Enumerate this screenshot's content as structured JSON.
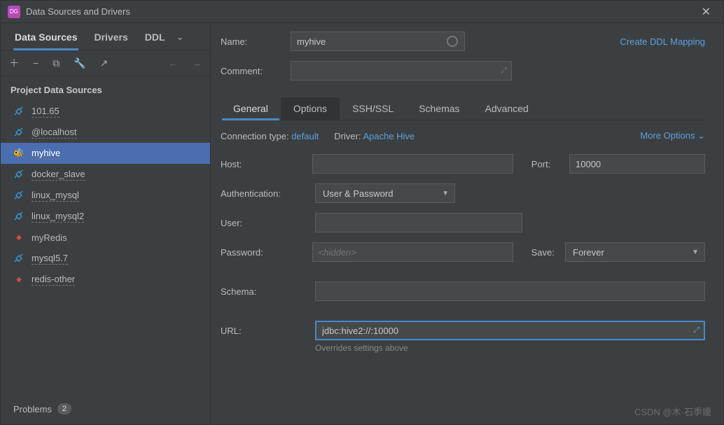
{
  "window": {
    "title": "Data Sources and Drivers"
  },
  "sidebar": {
    "tabs": [
      {
        "label": "Data Sources",
        "active": true
      },
      {
        "label": "Drivers",
        "active": false
      },
      {
        "label": "DDL",
        "active": false
      }
    ],
    "section_header": "Project Data Sources",
    "items": [
      {
        "label": "101.65",
        "icon": "plug",
        "dotted": true,
        "selected": false
      },
      {
        "label": "@localhost",
        "icon": "plug",
        "dotted": true,
        "selected": false
      },
      {
        "label": "myhive",
        "icon": "hive",
        "dotted": true,
        "selected": true
      },
      {
        "label": "docker_slave",
        "icon": "plug",
        "dotted": true,
        "selected": false
      },
      {
        "label": "linux_mysql",
        "icon": "plug",
        "dotted": true,
        "selected": false
      },
      {
        "label": "linux_mysql2",
        "icon": "plug",
        "dotted": true,
        "selected": false
      },
      {
        "label": "myRedis",
        "icon": "redis",
        "dotted": false,
        "selected": false
      },
      {
        "label": "mysql5.7",
        "icon": "plug",
        "dotted": true,
        "selected": false
      },
      {
        "label": "redis-other",
        "icon": "redis",
        "dotted": true,
        "selected": false
      }
    ],
    "problems_label": "Problems",
    "problems_count": "2"
  },
  "form": {
    "name_label": "Name:",
    "name_value": "myhive",
    "comment_label": "Comment:",
    "create_ddl_link": "Create DDL Mapping",
    "sub_tabs": [
      {
        "label": "General",
        "active": true
      },
      {
        "label": "Options",
        "bg": true
      },
      {
        "label": "SSH/SSL"
      },
      {
        "label": "Schemas"
      },
      {
        "label": "Advanced"
      }
    ],
    "conn_type_label": "Connection type:",
    "conn_type_value": "default",
    "driver_label": "Driver:",
    "driver_value": "Apache Hive",
    "more_options": "More Options",
    "host_label": "Host:",
    "host_value": "",
    "port_label": "Port:",
    "port_value": "10000",
    "auth_label": "Authentication:",
    "auth_value": "User & Password",
    "user_label": "User:",
    "user_value": "",
    "password_label": "Password:",
    "password_placeholder": "<hidden>",
    "save_label": "Save:",
    "save_value": "Forever",
    "schema_label": "Schema:",
    "schema_value": "",
    "url_label": "URL:",
    "url_value": "jdbc:hive2://:10000",
    "url_hint": "Overrides settings above"
  },
  "watermark": "CSDN @木·石季媛"
}
